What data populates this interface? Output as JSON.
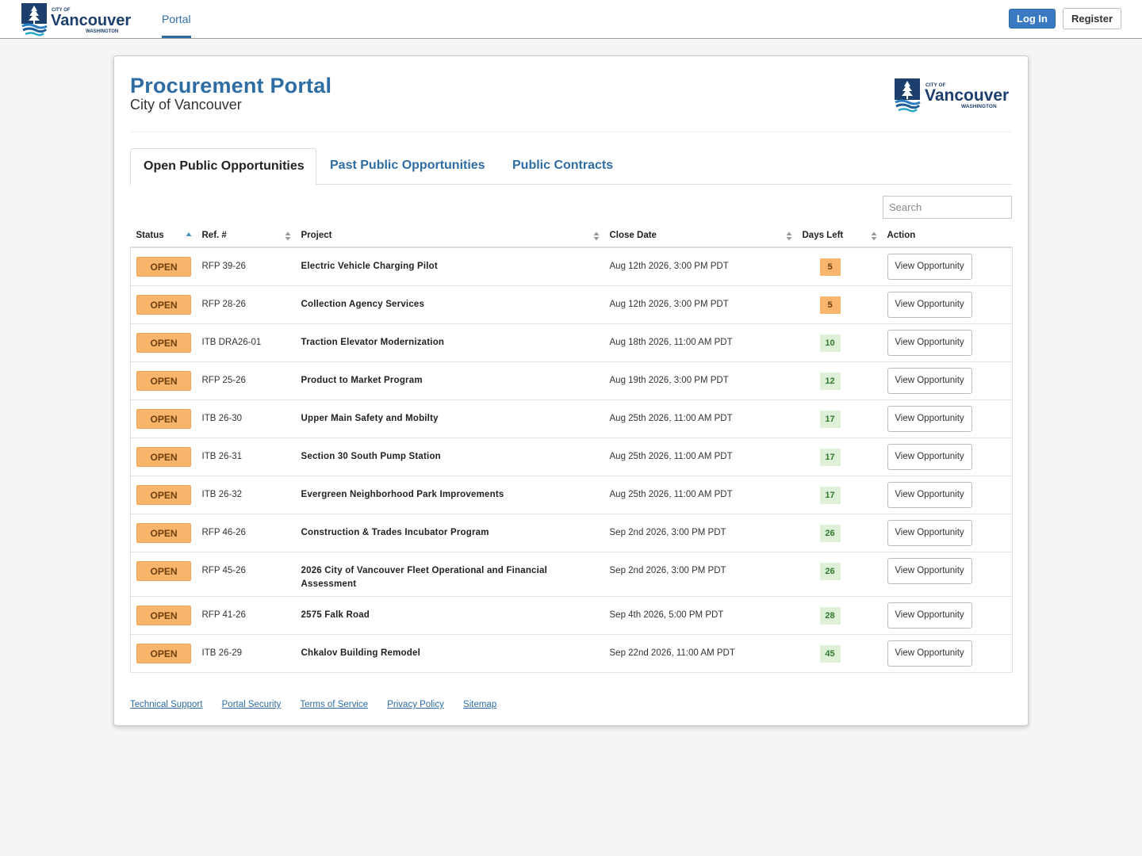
{
  "nav": {
    "portal_label": "Portal",
    "login_label": "Log In",
    "register_label": "Register"
  },
  "logo": {
    "city_of": "CITY OF",
    "name": "Vancouver",
    "state": "WASHINGTON"
  },
  "header": {
    "title": "Procurement Portal",
    "subtitle": "City of Vancouver"
  },
  "tabs": [
    {
      "label": "Open Public Opportunities",
      "active": true
    },
    {
      "label": "Past Public Opportunities",
      "active": false
    },
    {
      "label": "Public Contracts",
      "active": false
    }
  ],
  "search": {
    "placeholder": "Search"
  },
  "table": {
    "columns": [
      "Status",
      "Ref. #",
      "Project",
      "Close Date",
      "Days Left",
      "Action"
    ],
    "rows": [
      {
        "status": "OPEN",
        "ref": "RFP 39-26",
        "project": "Electric Vehicle Charging Pilot",
        "close": "Aug 12th 2026, 3:00 PM PDT",
        "days": "5",
        "action": "View Opportunity"
      },
      {
        "status": "OPEN",
        "ref": "RFP 28-26",
        "project": "Collection Agency Services",
        "close": "Aug 12th 2026, 3:00 PM PDT",
        "days": "5",
        "action": "View Opportunity"
      },
      {
        "status": "OPEN",
        "ref": "ITB DRA26-01",
        "project": "Traction Elevator Modernization",
        "close": "Aug 18th 2026, 11:00 AM PDT",
        "days": "10",
        "action": "View Opportunity"
      },
      {
        "status": "OPEN",
        "ref": "RFP 25-26",
        "project": "Product to Market Program",
        "close": "Aug 19th 2026, 3:00 PM PDT",
        "days": "12",
        "action": "View Opportunity"
      },
      {
        "status": "OPEN",
        "ref": "ITB 26-30",
        "project": "Upper Main Safety and Mobilty",
        "close": "Aug 25th 2026, 11:00 AM PDT",
        "days": "17",
        "action": "View Opportunity"
      },
      {
        "status": "OPEN",
        "ref": "ITB 26-31",
        "project": "Section 30 South Pump Station",
        "close": "Aug 25th 2026, 11:00 AM PDT",
        "days": "17",
        "action": "View Opportunity"
      },
      {
        "status": "OPEN",
        "ref": "ITB 26-32",
        "project": "Evergreen Neighborhood Park Improvements",
        "close": "Aug 25th 2026, 11:00 AM PDT",
        "days": "17",
        "action": "View Opportunity"
      },
      {
        "status": "OPEN",
        "ref": "RFP 46-26",
        "project": "Construction & Trades Incubator Program",
        "close": "Sep 2nd 2026, 3:00 PM PDT",
        "days": "26",
        "action": "View Opportunity"
      },
      {
        "status": "OPEN",
        "ref": "RFP 45-26",
        "project": "2026 City of Vancouver Fleet Operational and Financial Assessment",
        "close": "Sep 2nd 2026, 3:00 PM PDT",
        "days": "26",
        "action": "View Opportunity"
      },
      {
        "status": "OPEN",
        "ref": "RFP 41-26",
        "project": "2575 Falk Road",
        "close": "Sep 4th 2026, 5:00 PM PDT",
        "days": "28",
        "action": "View Opportunity"
      },
      {
        "status": "OPEN",
        "ref": "ITB 26-29",
        "project": "Chkalov Building Remodel",
        "close": "Sep 22nd 2026, 11:00 AM PDT",
        "days": "45",
        "action": "View Opportunity"
      }
    ]
  },
  "footer": {
    "links": [
      "Technical Support",
      "Portal Security",
      "Terms of Service",
      "Privacy Policy",
      "Sitemap"
    ]
  },
  "colors": {
    "brand_blue": "#2e6da4",
    "open_badge": "#f9b56b",
    "days_ok": "#dff0d8"
  }
}
